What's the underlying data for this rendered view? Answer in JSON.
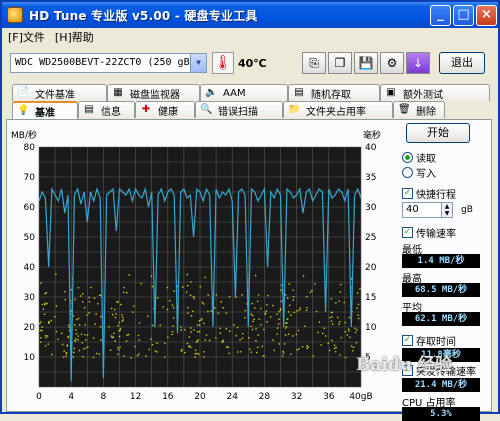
{
  "window": {
    "title": "HD Tune 专业版 v5.00 - 硬盘专业工具",
    "minimize": "_",
    "maximize": "□",
    "close": "×"
  },
  "menu": [
    "[F]文件",
    "[H]帮助"
  ],
  "toolbar": {
    "drive": "WDC WD2500BEVT-22ZCT0 (250 gB)",
    "temperature": "40℃",
    "exit": "退出",
    "icons": [
      "thermometer-icon",
      "copy-icon",
      "copy-text-icon",
      "save-icon",
      "options-icon",
      "download-icon"
    ]
  },
  "tabs_row1": [
    {
      "label": "文件基准",
      "icon": "file-benchmark-icon"
    },
    {
      "label": "磁盘监视器",
      "icon": "disk-monitor-icon"
    },
    {
      "label": "AAM",
      "icon": "speaker-icon"
    },
    {
      "label": "随机存取",
      "icon": "random-access-icon"
    },
    {
      "label": "额外测试",
      "icon": "extra-tests-icon"
    }
  ],
  "tabs_row2": [
    {
      "label": "基准",
      "icon": "benchmark-icon",
      "active": true
    },
    {
      "label": "信息",
      "icon": "info-icon"
    },
    {
      "label": "健康",
      "icon": "health-icon"
    },
    {
      "label": "错误扫描",
      "icon": "error-scan-icon"
    },
    {
      "label": "文件夹占用率",
      "icon": "folder-usage-icon"
    },
    {
      "label": "删除",
      "icon": "erase-icon"
    }
  ],
  "controls": {
    "start": "开始",
    "read": "读取",
    "write": "写入",
    "read_selected": true,
    "short_stroke": "快捷行程",
    "short_stroke_value": "40",
    "short_stroke_unit": "gB",
    "transfer_rate": "传输速率",
    "min_label": "最低",
    "min_value": "1.4 MB/秒",
    "max_label": "最高",
    "max_value": "68.5 MB/秒",
    "avg_label": "平均",
    "avg_value": "62.1 MB/秒",
    "access_time": "存取时间",
    "access_value": "11.8毫秒",
    "burst_label": "突发传输速率",
    "burst_value": "21.4 MB/秒",
    "cpu_label": "CPU 占用率",
    "cpu_value": "5.3%"
  },
  "colors": {
    "plot_bg": "#1a1a1a",
    "grid": "#5a5a5a",
    "transfer_line": "#3aa7cf",
    "access_points": "#d4d21a",
    "title_blue": "#0054e3"
  },
  "chart_data": {
    "type": "line",
    "y_left_label": "MB/秒",
    "y_right_label": "毫秒",
    "x_unit": "gB",
    "x_ticks": [
      "0",
      "4",
      "8",
      "12",
      "16",
      "20",
      "24",
      "28",
      "32",
      "36",
      "40gB"
    ],
    "y_left_ticks": [
      "80",
      "70",
      "60",
      "50",
      "40",
      "30",
      "20",
      "10"
    ],
    "y_right_ticks": [
      "40",
      "35",
      "30",
      "25",
      "20",
      "15",
      "10",
      "5"
    ],
    "xlim": [
      0,
      40
    ],
    "ylim_left": [
      0,
      80
    ],
    "ylim_right": [
      0,
      40
    ],
    "grid": true,
    "series": [
      {
        "kind": "transfer_rate",
        "x": [
          0,
          0.4,
          0.8,
          1.2,
          1.6,
          2.0,
          2.4,
          2.8,
          3.2,
          3.6,
          4.0,
          4.4,
          4.8,
          5.2,
          5.6,
          6.0,
          6.4,
          6.8,
          7.2,
          7.6,
          8.0,
          8.4,
          8.8,
          9.2,
          9.6,
          10.0,
          10.4,
          10.8,
          11.2,
          11.6,
          12.0,
          12.4,
          12.8,
          13.2,
          13.6,
          14.0,
          14.4,
          14.8,
          15.2,
          15.6,
          16.0,
          16.4,
          16.8,
          17.2,
          17.6,
          18.0,
          18.4,
          18.8,
          19.2,
          19.6,
          20.0,
          20.4,
          20.8,
          21.2,
          21.6,
          22.0,
          22.4,
          22.8,
          23.2,
          23.6,
          24.0,
          24.4,
          24.8,
          25.2,
          25.6,
          26.0,
          26.4,
          26.8,
          27.2,
          27.6,
          28.0,
          28.4,
          28.8,
          29.2,
          29.6,
          30.0,
          30.4,
          30.8,
          31.2,
          31.6,
          32.0,
          32.4,
          32.8,
          33.2,
          33.6,
          34.0,
          34.4,
          34.8,
          35.2,
          35.6,
          36.0,
          36.4,
          36.8,
          37.2,
          37.6,
          38.0,
          38.4,
          38.8,
          39.2,
          39.6,
          40.0
        ],
        "y": [
          62,
          65,
          63,
          40,
          66,
          64,
          62,
          66,
          58,
          64,
          2,
          64,
          66,
          61,
          65,
          55,
          65,
          62,
          66,
          63,
          3,
          64,
          65,
          66,
          52,
          66,
          65,
          64,
          66,
          62,
          66,
          64,
          63,
          66,
          60,
          65,
          20,
          64,
          66,
          62,
          65,
          66,
          64,
          18,
          65,
          66,
          63,
          64,
          50,
          66,
          65,
          62,
          66,
          64,
          20,
          66,
          63,
          65,
          64,
          66,
          62,
          30,
          65,
          66,
          64,
          20,
          66,
          65,
          62,
          64,
          66,
          40,
          65,
          63,
          66,
          64,
          20,
          66,
          65,
          63,
          64,
          66,
          58,
          65,
          66,
          62,
          64,
          66,
          65,
          25,
          66,
          63,
          64,
          66,
          65,
          62,
          66,
          20,
          64,
          66,
          63
        ]
      },
      {
        "kind": "access_time",
        "style": "scatter",
        "summary": "dense scatter between roughly 5 and 20 ms across full range"
      }
    ]
  },
  "watermark": "Baidu 经验"
}
